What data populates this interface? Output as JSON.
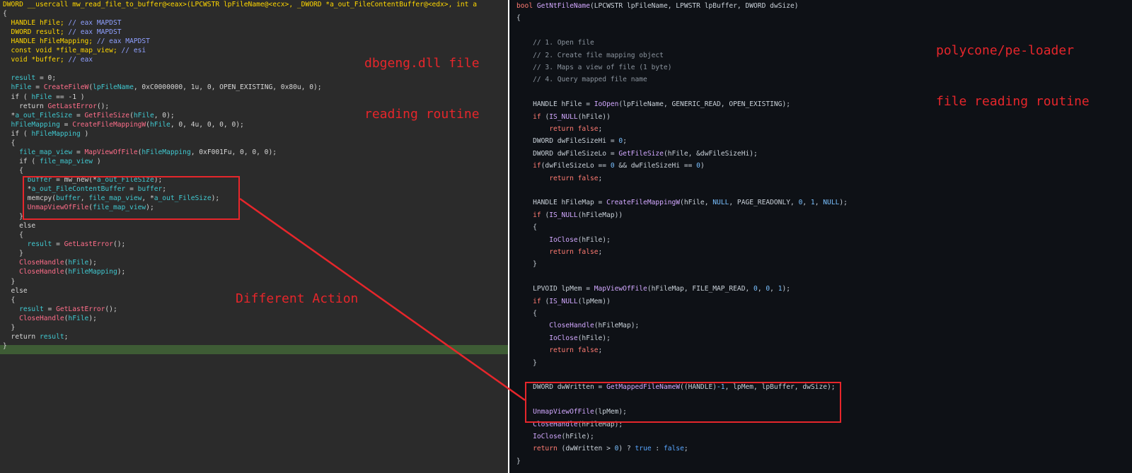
{
  "left_pane": {
    "lines": [
      [
        [
          "y",
          "DWORD __usercall mw_read_file_to_buffer@<eax>(LPCWSTR lpFileName@<ecx>, _DWORD *a_out_FileContentBuffer@<edx>, int a"
        ]
      ],
      [
        [
          "t",
          "{"
        ]
      ],
      [
        [
          "y",
          "  HANDLE hFile; "
        ],
        [
          "c",
          "// eax MAPDST"
        ]
      ],
      [
        [
          "y",
          "  DWORD result; "
        ],
        [
          "c",
          "// eax MAPDST"
        ]
      ],
      [
        [
          "y",
          "  HANDLE hFileMapping; "
        ],
        [
          "c",
          "// eax MAPDST"
        ]
      ],
      [
        [
          "y",
          "  const void *file_map_view; "
        ],
        [
          "c",
          "// esi"
        ]
      ],
      [
        [
          "y",
          "  void *buffer; "
        ],
        [
          "c",
          "// eax"
        ]
      ],
      [
        [
          "t",
          ""
        ]
      ],
      [
        [
          "v",
          "  result"
        ],
        [
          "t",
          " = 0;"
        ]
      ],
      [
        [
          "v",
          "  hFile"
        ],
        [
          "t",
          " = "
        ],
        [
          "f",
          "CreateFileW"
        ],
        [
          "t",
          "("
        ],
        [
          "v",
          "lpFileName"
        ],
        [
          "t",
          ", 0xC0000000, 1u, 0, OPEN_EXISTING, 0x80u, 0);"
        ]
      ],
      [
        [
          "t",
          "  if ( "
        ],
        [
          "v",
          "hFile"
        ],
        [
          "t",
          " == -1 )"
        ]
      ],
      [
        [
          "t",
          "    return "
        ],
        [
          "f",
          "GetLastError"
        ],
        [
          "t",
          "();"
        ]
      ],
      [
        [
          "t",
          "  *"
        ],
        [
          "v",
          "a_out_FileSize"
        ],
        [
          "t",
          " = "
        ],
        [
          "f",
          "GetFileSize"
        ],
        [
          "t",
          "("
        ],
        [
          "v",
          "hFile"
        ],
        [
          "t",
          ", 0);"
        ]
      ],
      [
        [
          "v",
          "  hFileMapping"
        ],
        [
          "t",
          " = "
        ],
        [
          "f",
          "CreateFileMappingW"
        ],
        [
          "t",
          "("
        ],
        [
          "v",
          "hFile"
        ],
        [
          "t",
          ", 0, 4u, 0, 0, 0);"
        ]
      ],
      [
        [
          "t",
          "  if ( "
        ],
        [
          "v",
          "hFileMapping"
        ],
        [
          "t",
          " )"
        ]
      ],
      [
        [
          "t",
          "  {"
        ]
      ],
      [
        [
          "v",
          "    file_map_view"
        ],
        [
          "t",
          " = "
        ],
        [
          "f",
          "MapViewOfFile"
        ],
        [
          "t",
          "("
        ],
        [
          "v",
          "hFileMapping"
        ],
        [
          "t",
          ", 0xF001Fu, 0, 0, 0);"
        ]
      ],
      [
        [
          "t",
          "    if ( "
        ],
        [
          "v",
          "file_map_view"
        ],
        [
          "t",
          " )"
        ]
      ],
      [
        [
          "t",
          "    {"
        ]
      ],
      [
        [
          "v",
          "      buffer"
        ],
        [
          "t",
          " = mw_new(*"
        ],
        [
          "v",
          "a_out_FileSize"
        ],
        [
          "t",
          ");"
        ]
      ],
      [
        [
          "t",
          "      *"
        ],
        [
          "v",
          "a_out_FileContentBuffer"
        ],
        [
          "t",
          " = "
        ],
        [
          "v",
          "buffer"
        ],
        [
          "t",
          ";"
        ]
      ],
      [
        [
          "t",
          "      memcpy("
        ],
        [
          "v",
          "buffer"
        ],
        [
          "t",
          ", "
        ],
        [
          "v",
          "file_map_view"
        ],
        [
          "t",
          ", *"
        ],
        [
          "v",
          "a_out_FileSize"
        ],
        [
          "t",
          ");"
        ]
      ],
      [
        [
          "f",
          "      UnmapViewOfFile"
        ],
        [
          "t",
          "("
        ],
        [
          "v",
          "file_map_view"
        ],
        [
          "t",
          ");"
        ]
      ],
      [
        [
          "t",
          "    }"
        ]
      ],
      [
        [
          "t",
          "    else"
        ]
      ],
      [
        [
          "t",
          "    {"
        ]
      ],
      [
        [
          "v",
          "      result"
        ],
        [
          "t",
          " = "
        ],
        [
          "f",
          "GetLastError"
        ],
        [
          "t",
          "();"
        ]
      ],
      [
        [
          "t",
          "    }"
        ]
      ],
      [
        [
          "f",
          "    CloseHandle"
        ],
        [
          "t",
          "("
        ],
        [
          "v",
          "hFile"
        ],
        [
          "t",
          ");"
        ]
      ],
      [
        [
          "f",
          "    CloseHandle"
        ],
        [
          "t",
          "("
        ],
        [
          "v",
          "hFileMapping"
        ],
        [
          "t",
          ");"
        ]
      ],
      [
        [
          "t",
          "  }"
        ]
      ],
      [
        [
          "t",
          "  else"
        ]
      ],
      [
        [
          "t",
          "  {"
        ]
      ],
      [
        [
          "v",
          "    result"
        ],
        [
          "t",
          " = "
        ],
        [
          "f",
          "GetLastError"
        ],
        [
          "t",
          "();"
        ]
      ],
      [
        [
          "f",
          "    CloseHandle"
        ],
        [
          "t",
          "("
        ],
        [
          "v",
          "hFile"
        ],
        [
          "t",
          ");"
        ]
      ],
      [
        [
          "t",
          "  }"
        ]
      ],
      [
        [
          "t",
          "  return "
        ],
        [
          "v",
          "result"
        ],
        [
          "t",
          ";"
        ]
      ],
      [
        [
          "t",
          "}"
        ]
      ]
    ]
  },
  "right_pane": {
    "lines": [
      [
        [
          "rk",
          "bool "
        ],
        [
          "rf",
          "GetNtFileName"
        ],
        [
          "rt",
          "(LPCWSTR lpFileName, LPWSTR lpBuffer, DWORD dwSize)"
        ]
      ],
      [
        [
          "rt",
          "{"
        ]
      ],
      [
        [
          "rt",
          ""
        ]
      ],
      [
        [
          "rc",
          "    // 1. Open file"
        ]
      ],
      [
        [
          "rc",
          "    // 2. Create file mapping object"
        ]
      ],
      [
        [
          "rc",
          "    // 3. Maps a view of file (1 byte)"
        ]
      ],
      [
        [
          "rc",
          "    // 4. Query mapped file name"
        ]
      ],
      [
        [
          "rt",
          ""
        ]
      ],
      [
        [
          "rt",
          "    HANDLE hFile = "
        ],
        [
          "rf",
          "IoOpen"
        ],
        [
          "rt",
          "(lpFileName, GENERIC_READ, OPEN_EXISTING);"
        ]
      ],
      [
        [
          "rk",
          "    if "
        ],
        [
          "rt",
          "("
        ],
        [
          "rf",
          "IS_NULL"
        ],
        [
          "rt",
          "(hFile))"
        ]
      ],
      [
        [
          "rk",
          "        return false"
        ],
        [
          "rt",
          ";"
        ]
      ],
      [
        [
          "rt",
          "    DWORD dwFileSizeHi = "
        ],
        [
          "rn",
          "0"
        ],
        [
          "rt",
          ";"
        ]
      ],
      [
        [
          "rt",
          "    DWORD dwFileSizeLo = "
        ],
        [
          "rf",
          "GetFileSize"
        ],
        [
          "rt",
          "(hFile, &dwFileSizeHi);"
        ]
      ],
      [
        [
          "rk",
          "    if"
        ],
        [
          "rt",
          "(dwFileSizeLo == "
        ],
        [
          "rn",
          "0"
        ],
        [
          "rt",
          " && dwFileSizeHi == "
        ],
        [
          "rn",
          "0"
        ],
        [
          "rt",
          ")"
        ]
      ],
      [
        [
          "rk",
          "        return false"
        ],
        [
          "rt",
          ";"
        ]
      ],
      [
        [
          "rt",
          ""
        ]
      ],
      [
        [
          "rt",
          "    HANDLE hFileMap = "
        ],
        [
          "rf",
          "CreateFileMappingW"
        ],
        [
          "rt",
          "(hFile, "
        ],
        [
          "rn",
          "NULL"
        ],
        [
          "rt",
          ", PAGE_READONLY, "
        ],
        [
          "rn",
          "0"
        ],
        [
          "rt",
          ", "
        ],
        [
          "rn",
          "1"
        ],
        [
          "rt",
          ", "
        ],
        [
          "rn",
          "NULL"
        ],
        [
          "rt",
          ");"
        ]
      ],
      [
        [
          "rk",
          "    if "
        ],
        [
          "rt",
          "("
        ],
        [
          "rf",
          "IS_NULL"
        ],
        [
          "rt",
          "(hFileMap))"
        ]
      ],
      [
        [
          "rt",
          "    {"
        ]
      ],
      [
        [
          "rf",
          "        IoClose"
        ],
        [
          "rt",
          "(hFile);"
        ]
      ],
      [
        [
          "rk",
          "        return false"
        ],
        [
          "rt",
          ";"
        ]
      ],
      [
        [
          "rt",
          "    }"
        ]
      ],
      [
        [
          "rt",
          ""
        ]
      ],
      [
        [
          "rt",
          "    LPVOID lpMem = "
        ],
        [
          "rf",
          "MapViewOfFile"
        ],
        [
          "rt",
          "(hFileMap, FILE_MAP_READ, "
        ],
        [
          "rn",
          "0"
        ],
        [
          "rt",
          ", "
        ],
        [
          "rn",
          "0"
        ],
        [
          "rt",
          ", "
        ],
        [
          "rn",
          "1"
        ],
        [
          "rt",
          ");"
        ]
      ],
      [
        [
          "rk",
          "    if "
        ],
        [
          "rt",
          "("
        ],
        [
          "rf",
          "IS_NULL"
        ],
        [
          "rt",
          "(lpMem))"
        ]
      ],
      [
        [
          "rt",
          "    {"
        ]
      ],
      [
        [
          "rf",
          "        CloseHandle"
        ],
        [
          "rt",
          "(hFileMap);"
        ]
      ],
      [
        [
          "rf",
          "        IoClose"
        ],
        [
          "rt",
          "(hFile);"
        ]
      ],
      [
        [
          "rk",
          "        return false"
        ],
        [
          "rt",
          ";"
        ]
      ],
      [
        [
          "rt",
          "    }"
        ]
      ],
      [
        [
          "rt",
          ""
        ]
      ],
      [
        [
          "rt",
          "    DWORD dwWritten = "
        ],
        [
          "rf",
          "GetMappedFileNameW"
        ],
        [
          "rt",
          "((HANDLE)"
        ],
        [
          "rn",
          "-1"
        ],
        [
          "rt",
          ", lpMem, lpBuffer, dwSize);"
        ]
      ],
      [
        [
          "rt",
          ""
        ]
      ],
      [
        [
          "rf",
          "    UnmapViewOfFile"
        ],
        [
          "rt",
          "(lpMem);"
        ]
      ],
      [
        [
          "rf",
          "    CloseHandle"
        ],
        [
          "rt",
          "(hFileMap);"
        ]
      ],
      [
        [
          "rf",
          "    IoClose"
        ],
        [
          "rt",
          "(hFile);"
        ]
      ],
      [
        [
          "rk",
          "    return "
        ],
        [
          "rt",
          "(dwWritten > "
        ],
        [
          "rn",
          "0"
        ],
        [
          "rt",
          ") ? "
        ],
        [
          "rb",
          "true"
        ],
        [
          "rt",
          " : "
        ],
        [
          "rb",
          "false"
        ],
        [
          "rt",
          ";"
        ]
      ],
      [
        [
          "rt",
          "}"
        ]
      ]
    ]
  },
  "annotations": {
    "left_title_1": "dbgeng.dll file",
    "left_title_2": "reading routine",
    "right_title_1": "polycone/pe-loader",
    "right_title_2": "file reading routine",
    "middle_label": "Different Action"
  },
  "colors": {
    "annotation_red": "#e6262b",
    "left_bg": "#2b2b2b",
    "right_bg": "#0e1116",
    "highlight_green": "#3e5c35"
  }
}
